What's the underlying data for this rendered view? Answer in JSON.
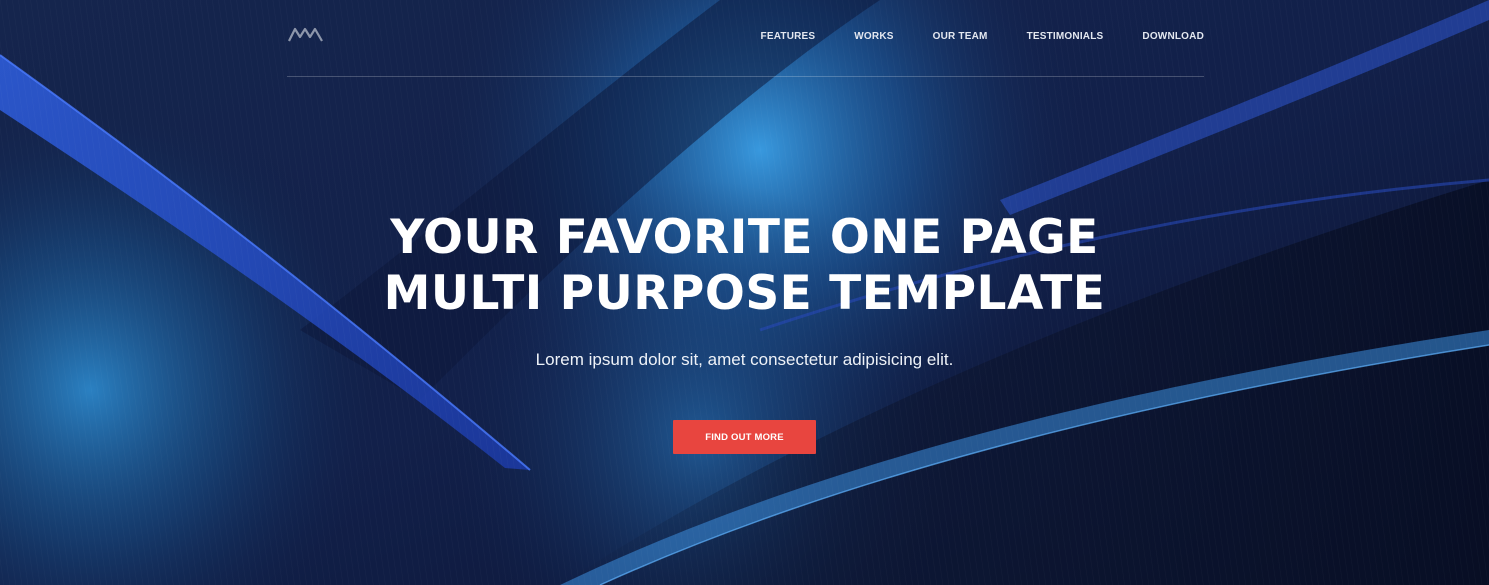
{
  "nav": {
    "logo_icon": "mountain-logo-icon",
    "items": [
      {
        "label": "FEATURES"
      },
      {
        "label": "WORKS"
      },
      {
        "label": "OUR TEAM"
      },
      {
        "label": "TESTIMONIALS"
      },
      {
        "label": "DOWNLOAD"
      }
    ]
  },
  "hero": {
    "title_line1": "YOUR FAVORITE ONE PAGE",
    "title_line2": "MULTI PURPOSE TEMPLATE",
    "subtitle": "Lorem ipsum dolor sit, amet consectetur adipisicing elit.",
    "cta_label": "FIND OUT MORE"
  },
  "colors": {
    "accent": "#e8453f",
    "background": "#0b1530",
    "highlight": "#2e8fd8"
  }
}
